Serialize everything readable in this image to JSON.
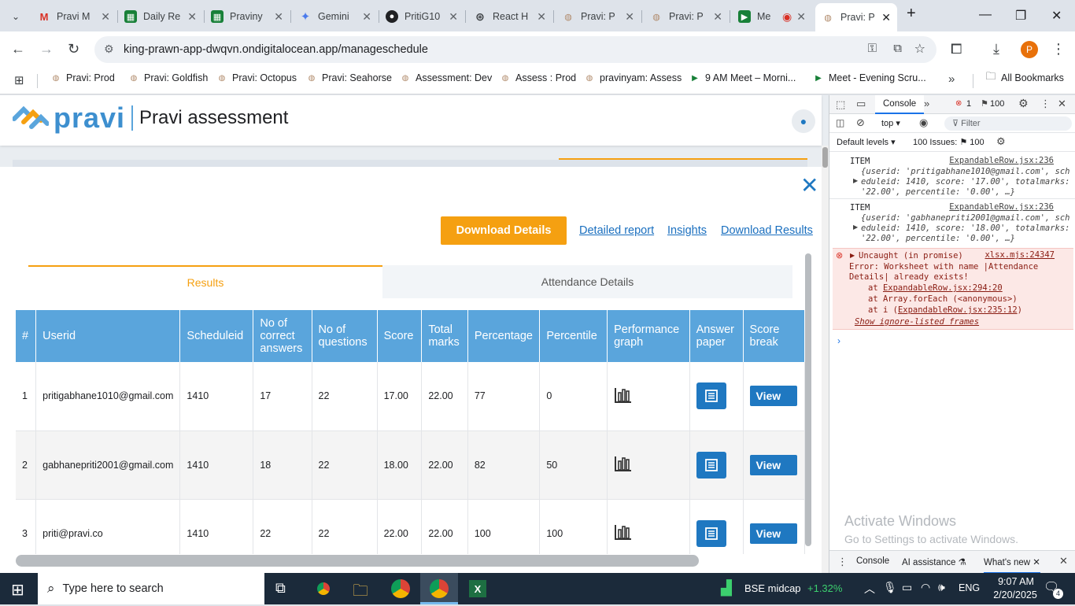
{
  "tabs": [
    {
      "title": "Pravi M",
      "icon": "gmail-icon",
      "color": "#d93025"
    },
    {
      "title": "Daily Re",
      "icon": "sheets-icon",
      "color": "#188038"
    },
    {
      "title": "Praviny",
      "icon": "sheets-icon",
      "color": "#188038"
    },
    {
      "title": "Gemini",
      "icon": "gemini-icon",
      "color": "#4b7bec"
    },
    {
      "title": "PritiG10",
      "icon": "github-icon",
      "color": "#202124"
    },
    {
      "title": "React H",
      "icon": "chatgpt-icon",
      "color": "#202124"
    },
    {
      "title": "Pravi: P",
      "icon": "pravi-icon",
      "color": "#b08a6a"
    },
    {
      "title": "Pravi: P",
      "icon": "pravi-icon",
      "color": "#b08a6a"
    },
    {
      "title": "Me",
      "icon": "meet-icon",
      "color": "#188038"
    },
    {
      "title": "Pravi: P",
      "icon": "pravi-icon",
      "color": "#b08a6a",
      "active": true
    }
  ],
  "address": {
    "url": "king-prawn-app-dwqvn.ondigitalocean.app/manageschedule"
  },
  "bookmarks": [
    "Pravi: Prod",
    "Pravi: Goldfish",
    "Pravi: Octopus",
    "Pravi: Seahorse",
    "Assessment: Dev",
    "Assess : Prod",
    "pravinyam: Assess",
    "9 AM Meet – Morni...",
    "Meet - Evening Scru..."
  ],
  "bookmarks_all": "All Bookmarks",
  "app": {
    "brand": "pravi",
    "title": "Pravi assessment"
  },
  "modal": {
    "download_details": "Download Details",
    "detailed_report": "Detailed report",
    "insights": "Insights",
    "download_results": "Download Results",
    "tab_results": "Results",
    "tab_attendance": "Attendance Details",
    "columns": [
      "#",
      "Userid",
      "Scheduleid",
      "No of correct answers",
      "No of questions",
      "Score",
      "Total marks",
      "Percentage",
      "Percentile",
      "Performance graph",
      "Answer paper",
      "Score break"
    ],
    "view_label": "View",
    "rows": [
      {
        "n": "1",
        "userid": "pritigabhane1010@gmail.com",
        "scheduleid": "1410",
        "correct": "17",
        "questions": "22",
        "score": "17.00",
        "total": "22.00",
        "percentage": "77",
        "percentile": "0"
      },
      {
        "n": "2",
        "userid": "gabhanepriti2001@gmail.com",
        "scheduleid": "1410",
        "correct": "18",
        "questions": "22",
        "score": "18.00",
        "total": "22.00",
        "percentage": "82",
        "percentile": "50"
      },
      {
        "n": "3",
        "userid": "priti@pravi.co",
        "scheduleid": "1410",
        "correct": "22",
        "questions": "22",
        "score": "22.00",
        "total": "22.00",
        "percentage": "100",
        "percentile": "100"
      }
    ]
  },
  "devtools": {
    "tab_console": "Console",
    "errors": "1",
    "issues": "100",
    "context": "top",
    "filter": "Filter",
    "levels": "Default levels",
    "issues_label": "100 Issues:",
    "issues_count": "100",
    "logs": [
      {
        "label": "ITEM",
        "source": "ExpandableRow.jsx:236",
        "line1": "{userid: 'pritigabhane1010@gmail.com', sch",
        "line2": "eduleid: 1410, score: '17.00', totalmarks:",
        "line3": "'22.00', percentile: '0.00', …}"
      },
      {
        "label": "ITEM",
        "source": "ExpandableRow.jsx:236",
        "line1": "{userid: 'gabhanepriti2001@gmail.com', sch",
        "line2": "eduleid: 1410, score: '18.00', totalmarks:",
        "line3": "'22.00', percentile: '0.00', …}"
      }
    ],
    "error": {
      "title": "Uncaught (in promise)",
      "source": "xlsx.mjs:24347",
      "msg1": "Error: Worksheet with name |Attendance",
      "msg2": "Details| already exists!",
      "at1_pre": "at ",
      "at1_link": "ExpandableRow.jsx:294:20",
      "at2": "at Array.forEach (<anonymous>)",
      "at3_pre": "at i (",
      "at3_link": "ExpandableRow.jsx:235:12",
      "at3_post": ")",
      "ignore": "Show ignore-listed frames"
    },
    "activate_title": "Activate Windows",
    "activate_sub": "Go to Settings to activate Windows.",
    "drawer_console": "Console",
    "drawer_ai": "AI assistance",
    "drawer_whatsnew": "What's new"
  },
  "taskbar": {
    "search": "Type here to search",
    "stock_name": "BSE midcap",
    "stock_change": "+1.32%",
    "lang": "ENG",
    "time": "9:07 AM",
    "date": "2/20/2025",
    "notif": "4"
  }
}
